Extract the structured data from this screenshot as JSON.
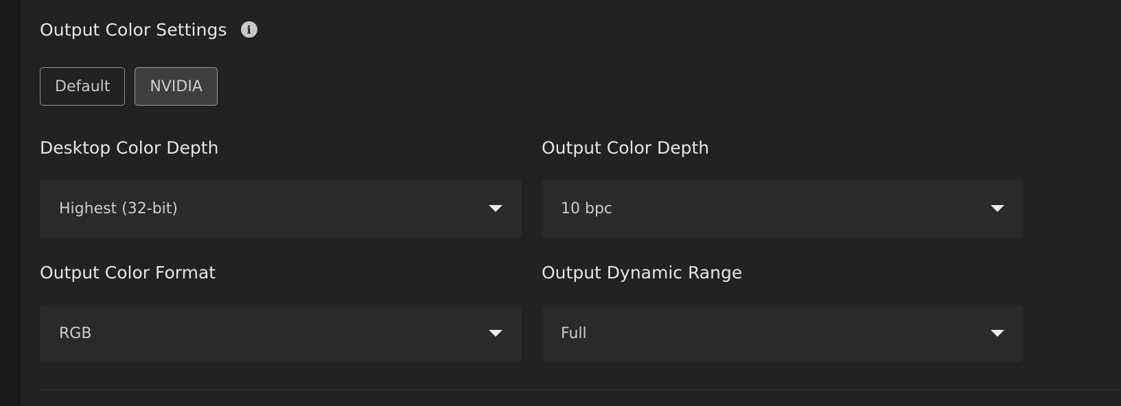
{
  "section": {
    "title": "Output Color Settings",
    "info_icon": "info-icon"
  },
  "presets": {
    "options": [
      "Default",
      "NVIDIA"
    ],
    "selected": "NVIDIA"
  },
  "fields": {
    "desktop_color_depth": {
      "label": "Desktop Color Depth",
      "value": "Highest (32-bit)"
    },
    "output_color_depth": {
      "label": "Output Color Depth",
      "value": "10 bpc"
    },
    "output_color_format": {
      "label": "Output Color Format",
      "value": "RGB"
    },
    "output_dynamic_range": {
      "label": "Output Dynamic Range",
      "value": "Full"
    }
  },
  "icons": {
    "dropdown": "chevron-down-icon"
  },
  "colors": {
    "background": "#222222",
    "field_background": "#2a2a2a",
    "active_preset": "#3f3f3f"
  }
}
